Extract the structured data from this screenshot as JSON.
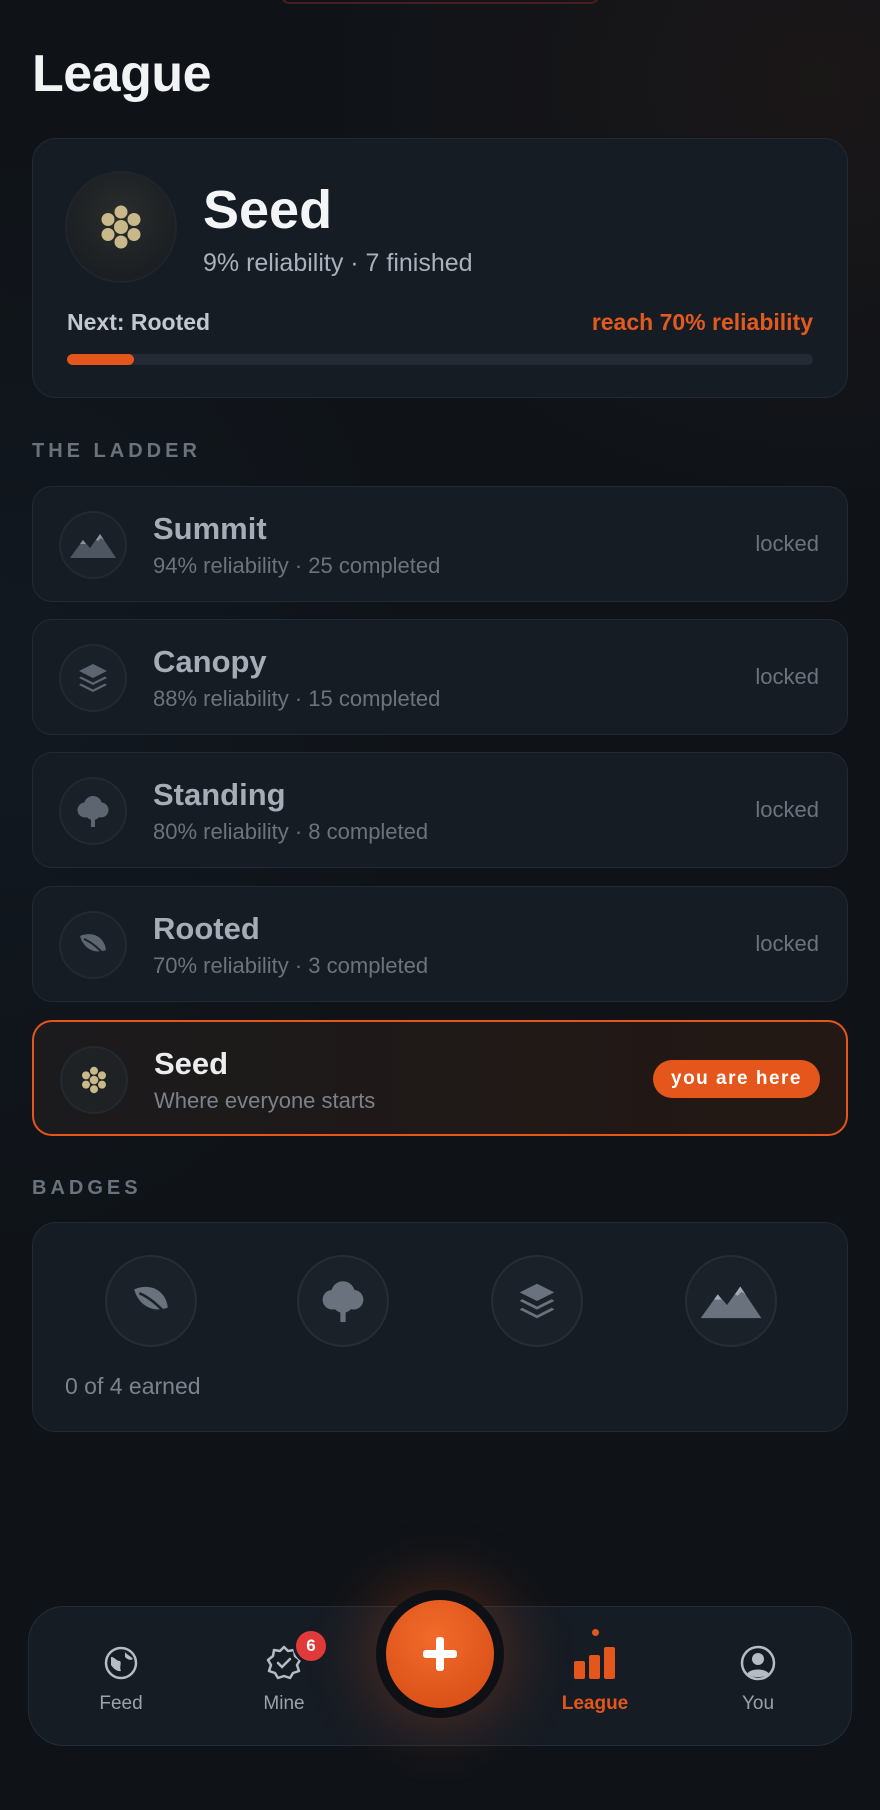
{
  "page": {
    "title": "League"
  },
  "current_tier": {
    "name": "Seed",
    "subtitle": "9% reliability · 7 finished",
    "next_label": "Next: Rooted",
    "target_label": "reach 70% reliability",
    "progress_fraction": 0.09,
    "icon": "seed-dots-icon"
  },
  "ladder": {
    "label": "THE LADDER",
    "tiers": [
      {
        "name": "Summit",
        "meta": "94% reliability · 25 completed",
        "state": "locked",
        "icon": "mountain-icon"
      },
      {
        "name": "Canopy",
        "meta": "88% reliability · 15 completed",
        "state": "locked",
        "icon": "layers-icon"
      },
      {
        "name": "Standing",
        "meta": "80% reliability · 8 completed",
        "state": "locked",
        "icon": "tree-icon"
      },
      {
        "name": "Rooted",
        "meta": "70% reliability · 3 completed",
        "state": "locked",
        "icon": "leaf-icon"
      },
      {
        "name": "Seed",
        "meta": "Where everyone starts",
        "state": "you are here",
        "icon": "seed-dots-icon"
      }
    ]
  },
  "badges": {
    "label": "BADGES",
    "items": [
      "leaf-icon",
      "tree-icon",
      "layers-icon",
      "mountain-icon"
    ],
    "count_label": "0 of 4 earned"
  },
  "nav": {
    "items": [
      {
        "label": "Feed",
        "icon": "globe-icon"
      },
      {
        "label": "Mine",
        "icon": "verified-badge-icon",
        "badge": "6"
      },
      {
        "label": "League",
        "icon": "bar-chart-icon",
        "active": true
      },
      {
        "label": "You",
        "icon": "user-circle-icon"
      }
    ],
    "fab_icon": "plus-icon"
  },
  "colors": {
    "accent": "#e4561c",
    "background": "#0f1318",
    "card": "#161c24",
    "notification": "#e03a3a",
    "seed_gold": "#c9b98a"
  }
}
